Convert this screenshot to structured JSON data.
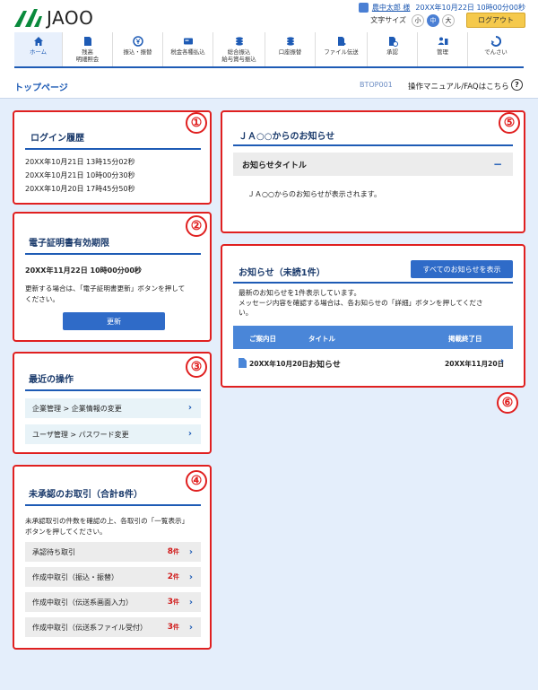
{
  "header": {
    "logo_text": "JAOO",
    "user_name": "農中太郎 様",
    "login_datetime": "20XX年10月22日 10時00分00秒",
    "font_size_label": "文字サイズ",
    "font_sizes": [
      "小",
      "中",
      "大"
    ],
    "font_size_selected": "中",
    "logout_label": "ログアウト"
  },
  "nav": [
    {
      "label": "ホーム",
      "icon": "home-icon"
    },
    {
      "label": "残高\n明細照会",
      "icon": "document-icon"
    },
    {
      "label": "振込・振替",
      "icon": "yen-transfer-icon"
    },
    {
      "label": "税金各種払込",
      "icon": "payment-icon"
    },
    {
      "label": "総合振込\n給与賞与振込",
      "icon": "coins-icon"
    },
    {
      "label": "口座振替",
      "icon": "coins-stack-icon"
    },
    {
      "label": "ファイル伝送",
      "icon": "file-send-icon"
    },
    {
      "label": "承認",
      "icon": "approval-icon"
    },
    {
      "label": "管理",
      "icon": "admin-icon"
    },
    {
      "label": "でんさい",
      "icon": "densai-icon"
    }
  ],
  "page": {
    "title": "トップページ",
    "screen_id": "BTOP001",
    "faq_label": "操作マニュアル/FAQはこちら",
    "help_icon": "?"
  },
  "panels": {
    "login_history": {
      "number": "①",
      "title": "ログイン履歴",
      "entries": [
        "20XX年10月21日 13時15分02秒",
        "20XX年10月21日 10時00分30秒",
        "20XX年10月20日 17時45分50秒"
      ]
    },
    "certificate": {
      "number": "②",
      "title": "電子証明書有効期限",
      "expiry": "20XX年11月22日 10時00分00秒",
      "note_line1": "更新する場合は、「電子証明書更新」ボタンを押して",
      "note_line2": "ください。",
      "button_label": "更新"
    },
    "recent_operations": {
      "number": "③",
      "title": "最近の操作",
      "items": [
        "企業管理 > 企業情報の変更",
        "ユーザ管理 > パスワード変更"
      ]
    },
    "unapproved": {
      "number": "④",
      "title": "未承認のお取引（合計8件）",
      "note_line1": "未承認取引の件数を確認の上、各取引の「一覧表示」",
      "note_line2": "ボタンを押してください。",
      "items": [
        {
          "label": "承認待ち取引",
          "count": "8",
          "unit": "件"
        },
        {
          "label": "作成中取引（振込・振替）",
          "count": "2",
          "unit": "件"
        },
        {
          "label": "作成中取引（伝送系画面入力）",
          "count": "3",
          "unit": "件"
        },
        {
          "label": "作成中取引（伝送系ファイル受付）",
          "count": "3",
          "unit": "件"
        }
      ]
    },
    "ja_notice": {
      "number": "⑤",
      "title": "ＪＡ○○からのお知らせ",
      "accordion_title": "お知らせタイトル",
      "accordion_body": "ＪＡ○○からのお知らせが表示されます。"
    },
    "notices": {
      "number": "⑥",
      "title": "お知らせ（未読1件）",
      "show_all_label": "すべてのお知らせを表示",
      "desc_line1": "最新のお知らせを1件表示しています。",
      "desc_line2": "メッセージ内容を確認する場合は、各お知らせの「詳細」ボタンを押してくださ",
      "desc_line3": "い。",
      "columns": [
        "ご案内日",
        "タイトル",
        "掲載終了日"
      ],
      "rows": [
        {
          "date": "20XX年10月20日",
          "title": "お知らせ",
          "end_date": "20XX年11月20日"
        }
      ]
    }
  },
  "colors": {
    "accent": "#1e5bb5",
    "highlight_border": "#e02020",
    "background": "#e4eefb",
    "logout": "#f5c94c"
  }
}
